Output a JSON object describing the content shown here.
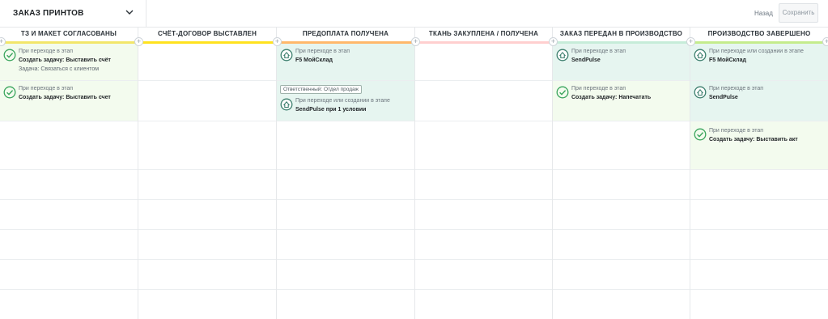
{
  "header": {
    "pipeline_name": "ЗАКАЗ ПРИНТОВ",
    "back_label": "Назад",
    "save_label": "Сохранить"
  },
  "colors": {
    "stage_1": "#f2e66a",
    "stage_2": "#ffe21f",
    "stage_3": "#ffb86b",
    "stage_4": "#ffcfcf",
    "stage_5": "#c6ecd9",
    "stage_6": "#c4ec8c",
    "cell_green": "#f3fbee",
    "cell_teal": "#e6f5f0",
    "check_icon": "#3aa55d",
    "integration_icon": "#3d7f6e"
  },
  "stages": [
    {
      "name": "ТЗ И МАКЕТ СОГЛАСОВАНЫ"
    },
    {
      "name": "СЧЁТ-ДОГОВОР ВЫСТАВЛЕН"
    },
    {
      "name": "ПРЕДОПЛАТА ПОЛУЧЕНА"
    },
    {
      "name": "ТКАНЬ ЗАКУПЛЕНА / ПОЛУЧЕНА"
    },
    {
      "name": "ЗАКАЗ ПЕРЕДАН В ПРОИЗВОДСТВО"
    },
    {
      "name": "ПРОИЗВОДСТВО ЗАВЕРШЕНО"
    }
  ],
  "triggers": {
    "c1r1": {
      "icon": "check-circle-icon",
      "when": "При переходе в этап",
      "action": "Создать задачу: Выставить счёт",
      "detail": "Задача: Связаться с клиентом"
    },
    "c1r2": {
      "icon": "check-circle-icon",
      "when": "При переходе в этап",
      "action": "Создать задачу: Выставить счет"
    },
    "c3r1": {
      "icon": "integration-icon",
      "when": "При переходе в этап",
      "action": "F5 МойСклад"
    },
    "c3r2": {
      "icon": "integration-icon",
      "responsible": "Ответственный: Отдел продаж",
      "when": "При переходе или создании в этапе",
      "action": "SendPulse при 1 условии"
    },
    "c5r1": {
      "icon": "integration-icon",
      "when": "При переходе в этап",
      "action": "SendPulse"
    },
    "c5r2": {
      "icon": "check-circle-icon",
      "when": "При переходе в этап",
      "action": "Создать задачу: Напечатать"
    },
    "c6r1": {
      "icon": "integration-icon",
      "when": "При переходе или создании в этапе",
      "action": "F5 МойСклад"
    },
    "c6r2": {
      "icon": "integration-icon",
      "when": "При переходе в этап",
      "action": "SendPulse"
    },
    "c6r3": {
      "icon": "check-circle-icon",
      "when": "При переходе в этап",
      "action": "Создать задачу: Выставить акт"
    }
  }
}
